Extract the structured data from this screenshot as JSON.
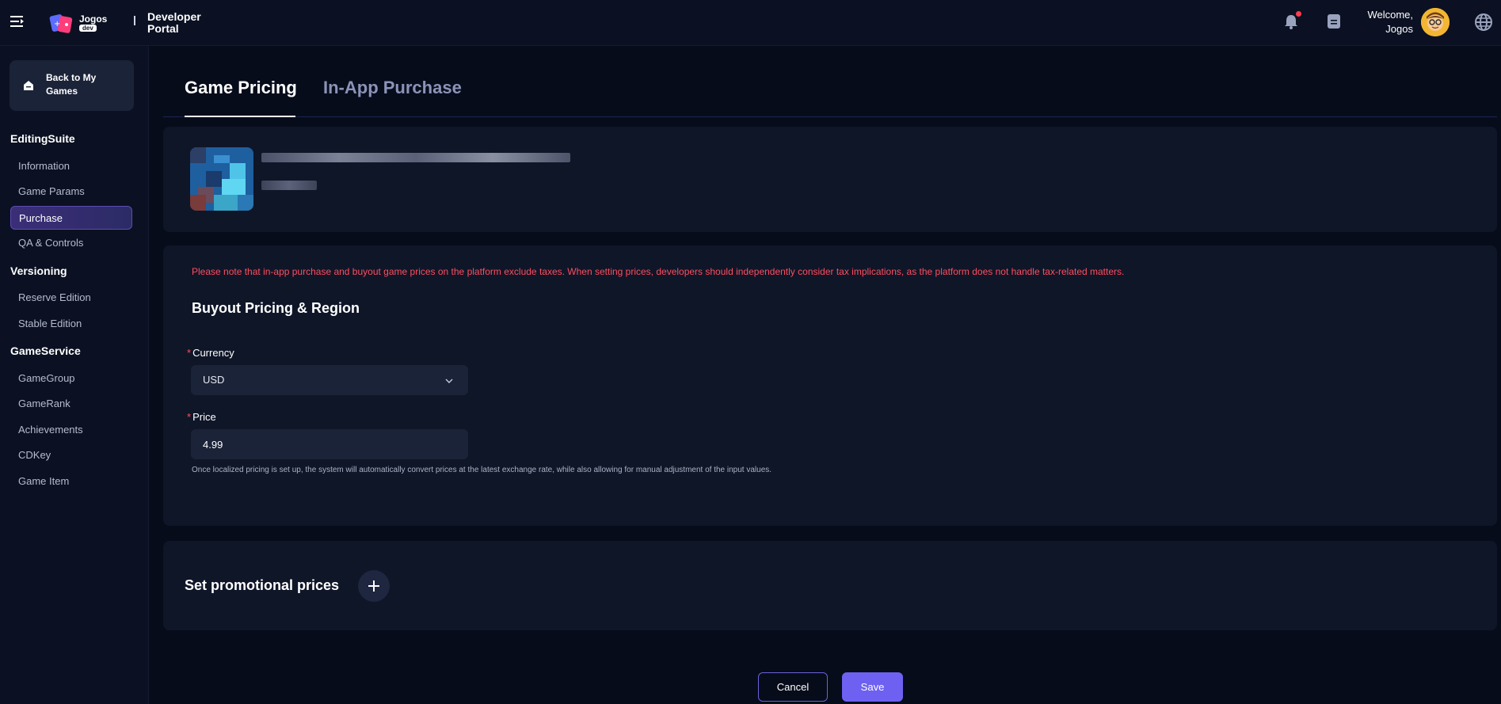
{
  "header": {
    "logo_text": "Jogos",
    "logo_badge": "dev",
    "portal_title": "Developer Portal",
    "welcome_line1": "Welcome,",
    "welcome_line2": "Jogos",
    "icons": [
      "menu-icon",
      "bell-icon",
      "document-icon",
      "avatar",
      "globe-icon"
    ],
    "notification_dot_color": "#ff3b4d"
  },
  "sidebar": {
    "back_label": "Back to My Games",
    "sections": [
      {
        "title": "EditingSuite",
        "items": [
          "Information",
          "Game Params",
          "Purchase",
          "QA & Controls"
        ]
      },
      {
        "title": "Versioning",
        "items": [
          "Reserve Edition",
          "Stable Edition"
        ]
      },
      {
        "title": "GameService",
        "items": [
          "GameGroup",
          "GameRank",
          "Achievements",
          "CDKey",
          "Game Item"
        ]
      }
    ],
    "active_item": "Purchase"
  },
  "tabs": [
    {
      "label": "Game Pricing",
      "active": true
    },
    {
      "label": "In-App Purchase",
      "active": false
    }
  ],
  "pricing": {
    "notice": "Please note that in-app purchase and buyout game prices on the platform exclude taxes. When setting prices, developers should independently consider tax implications, as the platform does not handle tax-related matters.",
    "section_title": "Buyout Pricing & Region",
    "required_mark": "*",
    "currency_label": "Currency",
    "currency_value": "USD",
    "price_label": "Price",
    "price_value": "4.99",
    "hint": "Once localized pricing is set up, the system will automatically convert prices at the latest exchange rate, while also allowing for manual adjustment of the input values."
  },
  "promo": {
    "title": "Set promotional prices"
  },
  "actions": {
    "cancel_label": "Cancel",
    "save_label": "Save"
  },
  "colors": {
    "accent": "#6e61f2",
    "warning": "#ff4d5e",
    "background": "#070c1b",
    "panel": "#0f1628"
  }
}
